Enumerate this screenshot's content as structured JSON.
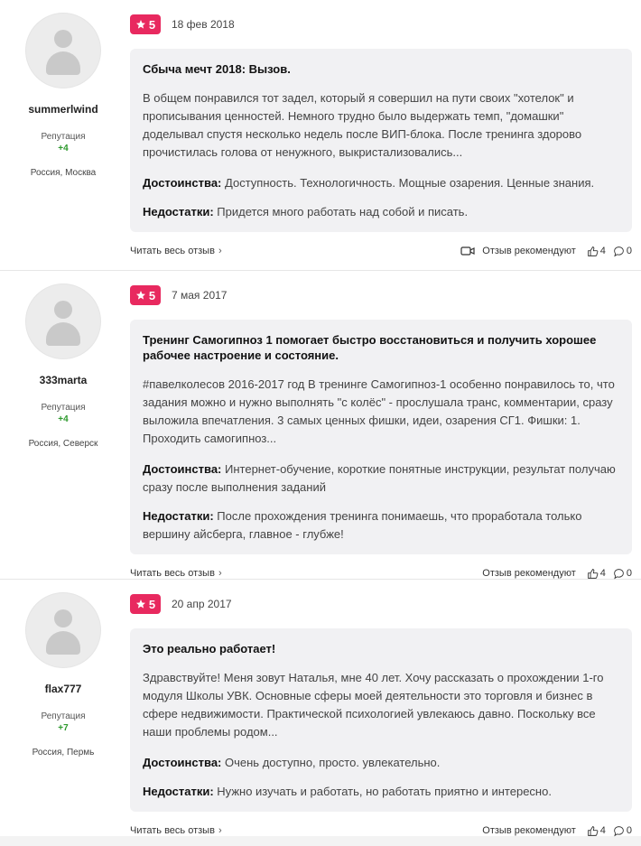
{
  "reviews": [
    {
      "username": "summerlwind",
      "reputation_label": "Репутация",
      "reputation": "+4",
      "location": "Россия, Москва",
      "rating": "5",
      "date": "18 фев 2018",
      "title": "Сбыча мечт 2018: Вызов.",
      "text": "В общем понравился тот задел, который я совершил на пути своих \"хотелок\" и прописывания ценностей. Немного трудно было выдержать темп, \"домашки\" доделывал спустя несколько недель после ВИП-блока. После тренинга здорово прочистилась голова от ненужного, выкристализовались...",
      "pros_label": "Достоинства:",
      "pros": "Доступность. Технологичность. Мощные озарения. Ценные знания.",
      "cons_label": "Недостатки:",
      "cons": "Придется много работать над собой и писать.",
      "read_more": "Читать весь отзыв",
      "recommend": "Отзыв рекомендуют",
      "likes": "4",
      "comments": "0",
      "has_video": true
    },
    {
      "username": "333marta",
      "reputation_label": "Репутация",
      "reputation": "+4",
      "location": "Россия, Северск",
      "rating": "5",
      "date": "7 мая 2017",
      "title": "Тренинг Самогипноз 1 помогает быстро восстановиться и получить хорошее рабочее настроение и состояние.",
      "text": "#павелколесов 2016-2017 год В тренинге Самогипноз-1 особенно понравилось то, что задания можно и нужно выполнять \"с колёс\" - прослушала транс, комментарии, сразу выложила впечатления. 3 самых ценных фишки, идеи, озарения СГ1. Фишки: 1. Проходить самогипноз...",
      "pros_label": "Достоинства:",
      "pros": "Интернет-обучение, короткие понятные инструкции, результат получаю сразу после выполнения заданий",
      "cons_label": "Недостатки:",
      "cons": "После прохождения тренинга понимаешь, что проработала только вершину айсберга, главное - глубже!",
      "read_more": "Читать весь отзыв",
      "recommend": "Отзыв рекомендуют",
      "likes": "4",
      "comments": "0",
      "has_video": false
    },
    {
      "username": "flax777",
      "reputation_label": "Репутация",
      "reputation": "+7",
      "location": "Россия, Пермь",
      "rating": "5",
      "date": "20 апр 2017",
      "title": "Это реально работает!",
      "text": "Здравствуйте! Меня зовут Наталья, мне 40 лет. Хочу рассказать о прохождении 1-го модуля Школы УВК. Основные сферы моей деятельности это торговля и бизнес в сфере недвижимости. Практической психологией увлекаюсь давно. Поскольку все наши проблемы родом...",
      "pros_label": "Достоинства:",
      "pros": "Очень доступно, просто. увлекательно.",
      "cons_label": "Недостатки:",
      "cons": "Нужно изучать и работать, но работать приятно и интересно.",
      "read_more": "Читать весь отзыв",
      "recommend": "Отзыв рекомендуют",
      "likes": "4",
      "comments": "0",
      "has_video": false
    }
  ],
  "colors": {
    "badge": "#e8295f",
    "reputation": "#2e9a2e",
    "card": "#f1f1f3"
  }
}
